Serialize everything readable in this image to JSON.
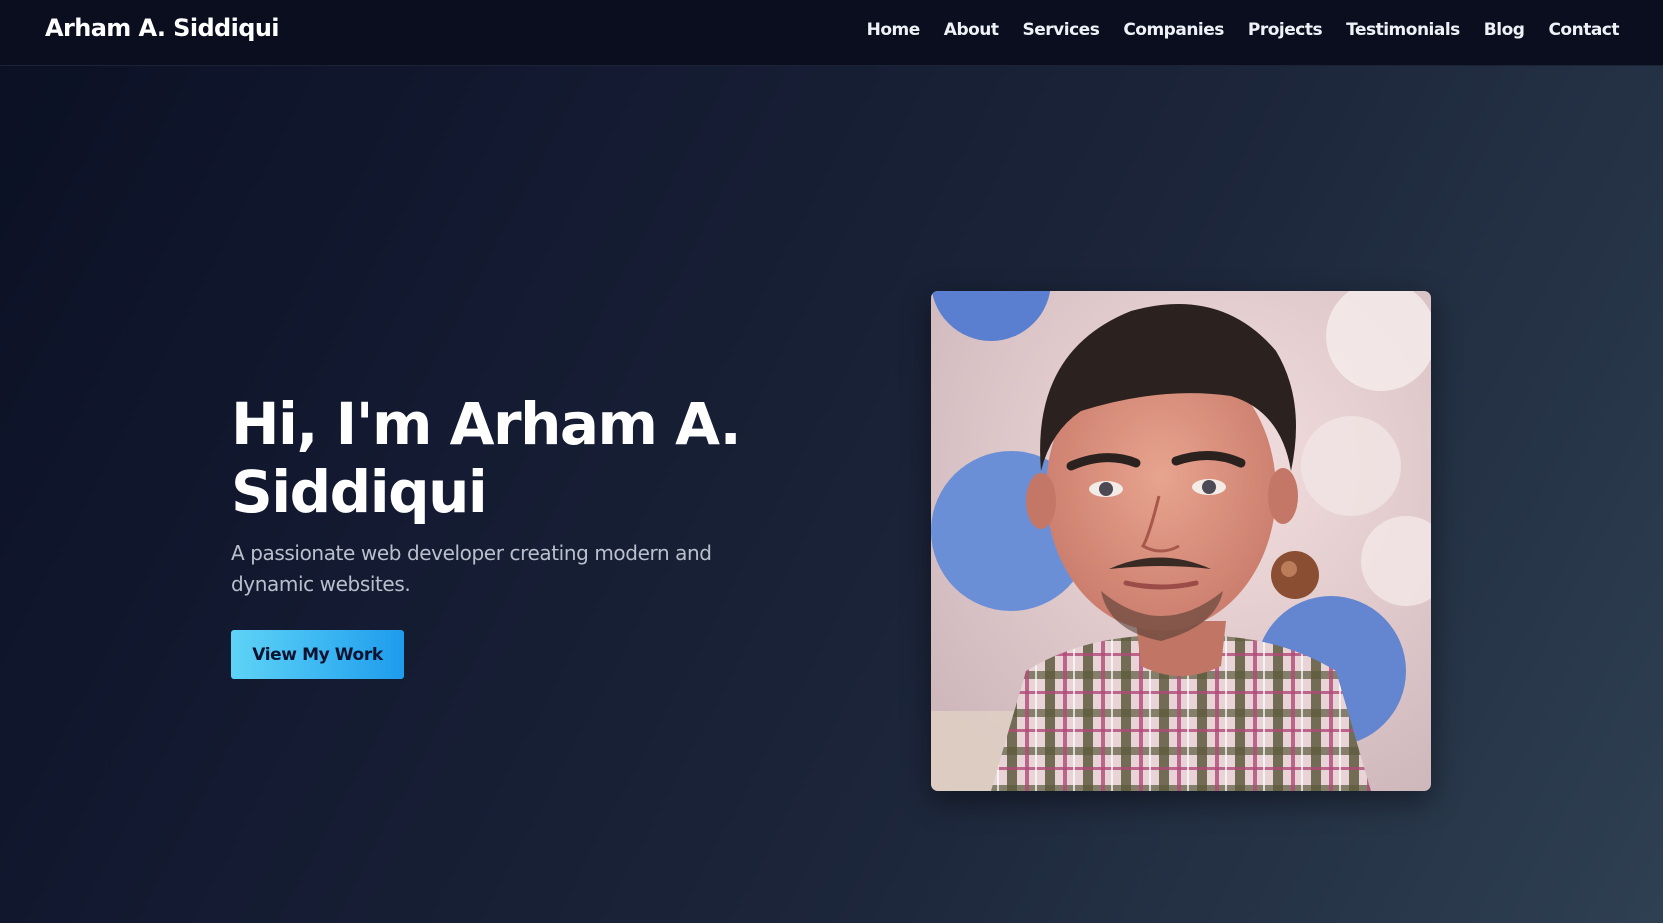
{
  "header": {
    "brand": "Arham A. Siddiqui",
    "nav": [
      "Home",
      "About",
      "Services",
      "Companies",
      "Projects",
      "Testimonials",
      "Blog",
      "Contact"
    ]
  },
  "hero": {
    "title_line1": "Hi, I'm Arham A.",
    "title_line2": "Siddiqui",
    "subtitle": "A passionate web developer creating modern and dynamic websites.",
    "cta_label": "View My Work"
  },
  "colors": {
    "accent": "#3bb6f2",
    "background_dark": "#0b1024",
    "background_light": "#2f4052",
    "navbar": "#0a0e1f"
  }
}
